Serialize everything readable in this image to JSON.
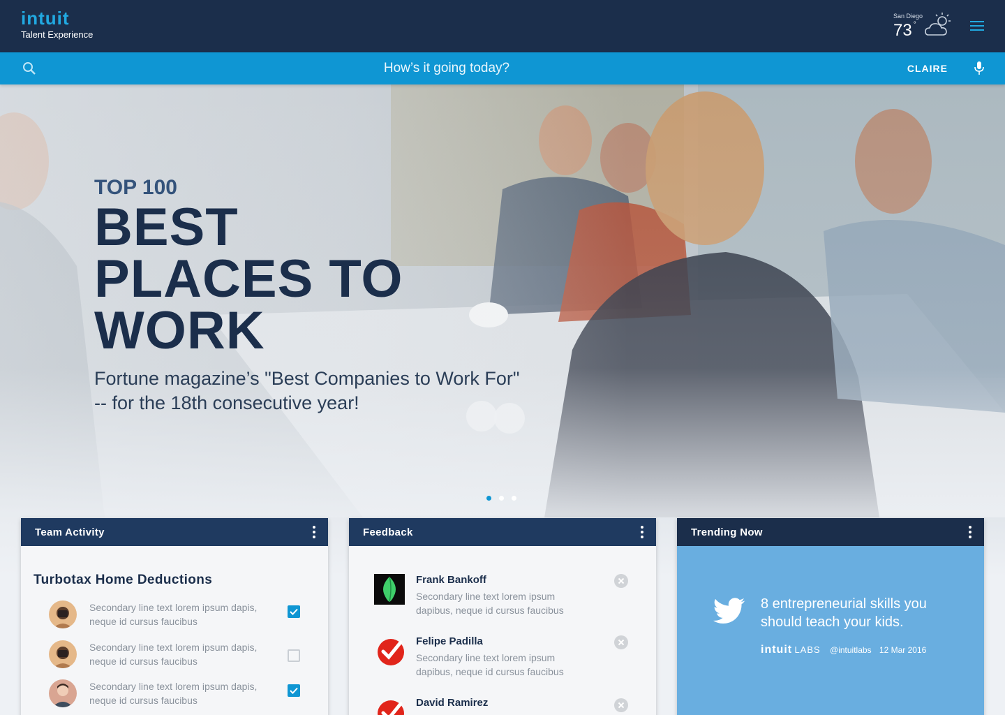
{
  "header": {
    "logo_word": "intuit",
    "logo_sub": "Talent Experience",
    "weather": {
      "city": "San Diego",
      "temp": "73",
      "deg": "°",
      "icon": "partly-cloudy-icon"
    },
    "menu_icon": "hamburger-menu-icon"
  },
  "search": {
    "placeholder": "How’s it going today?",
    "user": "CLAIRE",
    "icons": [
      "search-icon",
      "microphone-icon"
    ]
  },
  "hero": {
    "kicker": "TOP 100",
    "title_lines": [
      "BEST",
      "PLACES TO",
      "WORK"
    ],
    "subtitle_lines": [
      "Fortune magazine’s \"Best Companies to Work For\"",
      "-- for the 18th consecutive year!"
    ],
    "slides": 3,
    "active_slide": 1
  },
  "cards": {
    "team_activity": {
      "title": "Team Activity",
      "section": "Turbotax Home Deductions",
      "items": [
        {
          "text": "Secondary line text lorem ipsum dapis, neque id cursus faucibus",
          "checked": true
        },
        {
          "text": "Secondary line text lorem ipsum dapis, neque id cursus faucibus",
          "checked": false
        },
        {
          "text": "Secondary line text lorem ipsum dapis, neque id cursus faucibus",
          "checked": true
        }
      ]
    },
    "feedback": {
      "title": "Feedback",
      "items": [
        {
          "name": "Frank Bankoff",
          "text": "Secondary line text lorem ipsum dapibus, neque id cursus faucibus",
          "icon": "mint-leaf-icon"
        },
        {
          "name": "Felipe Padilla",
          "text": "Secondary line text lorem ipsum dapibus, neque id cursus faucibus",
          "icon": "red-check-icon"
        },
        {
          "name": "David Ramirez",
          "text": "",
          "icon": "red-check-icon"
        }
      ]
    },
    "trending": {
      "title": "Trending Now",
      "tweet": "8 entrepreneurial skills you should teach your kids.",
      "brand": "intuit",
      "labs": "LABS",
      "handle": "@intuitlabs",
      "date": "12 Mar 2016"
    }
  },
  "colors": {
    "navy": "#1b2e4b",
    "accent": "#0f96d3",
    "card_header": "#1f3a60",
    "trend_blue": "#69aee0"
  }
}
